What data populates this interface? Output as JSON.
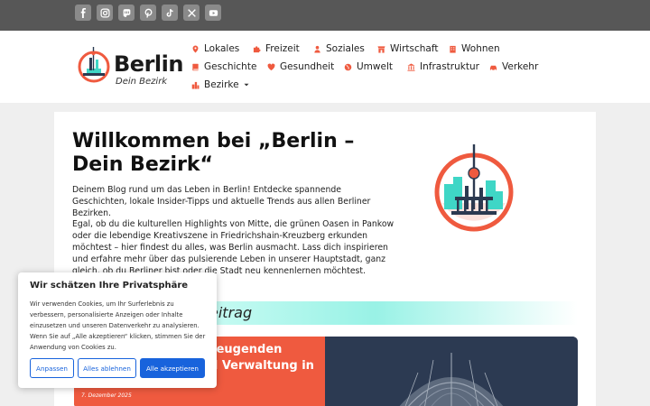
{
  "social": [
    "facebook-icon",
    "instagram-icon",
    "mastodon-icon",
    "pinterest-icon",
    "tiktok-icon",
    "x-icon",
    "youtube-icon"
  ],
  "brand": {
    "name": "Berlin",
    "tagline": "Dein Bezirk"
  },
  "nav": [
    {
      "label": "Lokales",
      "icon": "map-pin-icon",
      "color": "#ef5a3f"
    },
    {
      "label": "Freizeit",
      "icon": "puzzle-icon",
      "color": "#ef5a3f"
    },
    {
      "label": "Soziales",
      "icon": "people-icon",
      "color": "#ef5a3f"
    },
    {
      "label": "Wirtschaft",
      "icon": "shop-icon",
      "color": "#ef5a3f"
    },
    {
      "label": "Wohnen",
      "icon": "building-icon",
      "color": "#ef5a3f"
    },
    {
      "label": "Geschichte",
      "icon": "book-icon",
      "color": "#ef5a3f"
    },
    {
      "label": "Gesundheit",
      "icon": "heart-icon",
      "color": "#ef5a3f"
    },
    {
      "label": "Umwelt",
      "icon": "globe-icon",
      "color": "#ef5a3f"
    },
    {
      "label": "Infrastruktur",
      "icon": "landmark-icon",
      "color": "#ef5a3f"
    },
    {
      "label": "Verkehr",
      "icon": "car-icon",
      "color": "#ef5a3f"
    },
    {
      "label": "Bezirke",
      "icon": "city-icon",
      "color": "#ef5a3f"
    }
  ],
  "main": {
    "title": "Willkommen bei „Berlin – Dein Bezirk“",
    "intro": "Deinem Blog rund um das Leben in Berlin! Entdecke spannende Geschichten, lokale Insider-Tipps und aktuelle Trends aus allen Berliner Bezirken.",
    "paragraph2": "Egal, ob du die kulturellen Highlights von Mitte, die grünen Oasen in Pankow oder die lebendige Kreativszene in Friedrichshain-Kreuzberg erkunden möchtest – hier findest du alles, was Berlin ausmacht. Lass dich inspirieren und erfahre mehr über das pulsierende Leben in unserer Hauptstadt, ganz gleich, ob du Berliner bist oder die Stadt neu kennenlernen möchtest.",
    "featured_label": "eitrag"
  },
  "post": {
    "title_line1": "zeugenden",
    "title_line2": "d Verwaltung in",
    "date": "7. Dezember 2025"
  },
  "cookie": {
    "title": "Wir schätzen Ihre Privatsphäre",
    "text": "Wir verwenden Cookies, um Ihr Surferlebnis zu verbessern, personalisierte Anzeigen oder Inhalte einzusetzen und unseren Datenverkehr zu analysieren. Wenn Sie auf „Alle akzeptieren“ klicken, stimmen Sie der Anwendung von Cookies zu.",
    "btn_customize": "Anpassen",
    "btn_reject": "Alles ablehnen",
    "btn_accept": "Alle akzeptieren"
  },
  "colors": {
    "accent": "#ef5a3f",
    "teal": "#3fd6c6",
    "button_blue": "#1863dc",
    "topbar": "#575757"
  }
}
